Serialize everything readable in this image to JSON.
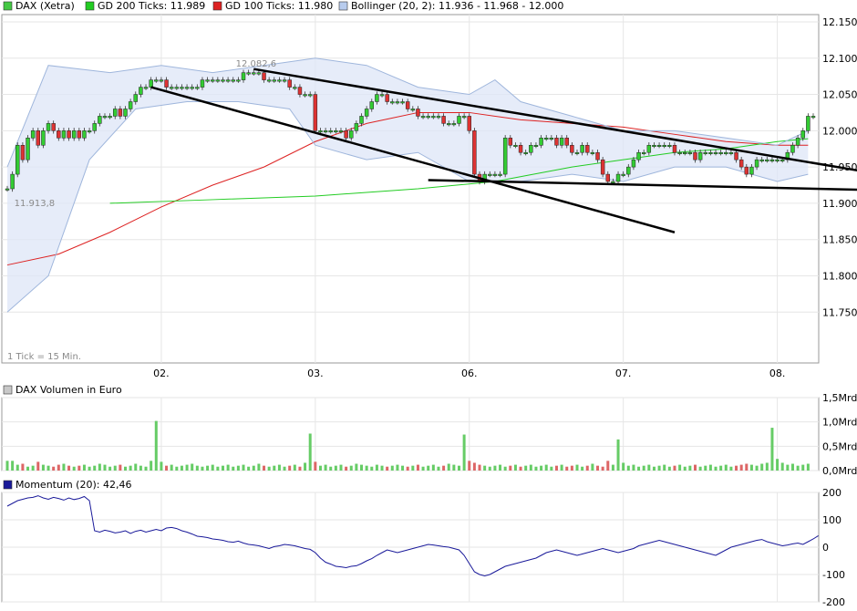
{
  "chart_data": [
    {
      "type": "candlestick",
      "panel": "price",
      "ylim": [
        11.68,
        12.16
      ],
      "grid": true,
      "legend_placement": "top-left",
      "legend": [
        {
          "label": "DAX (Xetra)",
          "color": "#44c844"
        },
        {
          "label": "GD 200 Ticks: 11.989",
          "color": "#22cc22"
        },
        {
          "label": "GD 100 Ticks: 11.980",
          "color": "#dd2222"
        },
        {
          "label": "Bollinger (20, 2): 11.936 - 11.968 - 12.000",
          "color": "#b8ccee"
        }
      ],
      "y_ticks": [
        {
          "value": 11.75,
          "label": "11.750"
        },
        {
          "value": 11.8,
          "label": "11.800"
        },
        {
          "value": 11.85,
          "label": "11.850"
        },
        {
          "value": 11.9,
          "label": "11.900"
        },
        {
          "value": 11.95,
          "label": "11.950"
        },
        {
          "value": 12.0,
          "label": "12.000"
        },
        {
          "value": 12.05,
          "label": "12.050"
        },
        {
          "value": 12.1,
          "label": "12.100"
        },
        {
          "value": 12.15,
          "label": "12.150"
        }
      ],
      "x_ticks": [
        {
          "index": 30,
          "label": "02."
        },
        {
          "index": 60,
          "label": "03."
        },
        {
          "index": 90,
          "label": "06."
        },
        {
          "index": 120,
          "label": "07."
        },
        {
          "index": 150,
          "label": "08."
        }
      ],
      "x_count": 158,
      "annotations": [
        {
          "text": "12.082,6",
          "index": 47,
          "value": 12.082
        },
        {
          "text": "11.913,8",
          "index": 1,
          "value": 11.914
        },
        {
          "text": "1 Tick = 15 Min.",
          "corner": "bottom-left"
        }
      ],
      "closes": [
        11.92,
        11.94,
        11.98,
        11.96,
        11.99,
        12.0,
        11.98,
        12.0,
        12.01,
        12.0,
        11.99,
        12.0,
        11.99,
        12.0,
        11.99,
        12.0,
        12.0,
        12.01,
        12.02,
        12.02,
        12.02,
        12.03,
        12.02,
        12.03,
        12.04,
        12.05,
        12.06,
        12.06,
        12.07,
        12.07,
        12.07,
        12.06,
        12.06,
        12.06,
        12.06,
        12.06,
        12.06,
        12.06,
        12.07,
        12.07,
        12.07,
        12.07,
        12.07,
        12.07,
        12.07,
        12.07,
        12.08,
        12.08,
        12.08,
        12.08,
        12.07,
        12.07,
        12.07,
        12.07,
        12.07,
        12.06,
        12.06,
        12.05,
        12.05,
        12.05,
        12.0,
        12.0,
        12.0,
        12.0,
        12.0,
        12.0,
        11.99,
        12.0,
        12.01,
        12.02,
        12.03,
        12.04,
        12.05,
        12.05,
        12.04,
        12.04,
        12.04,
        12.04,
        12.03,
        12.03,
        12.02,
        12.02,
        12.02,
        12.02,
        12.02,
        12.01,
        12.01,
        12.01,
        12.02,
        12.02,
        12.0,
        11.94,
        11.93,
        11.94,
        11.94,
        11.94,
        11.94,
        11.99,
        11.98,
        11.98,
        11.97,
        11.97,
        11.98,
        11.98,
        11.99,
        11.99,
        11.99,
        11.98,
        11.99,
        11.98,
        11.97,
        11.97,
        11.98,
        11.97,
        11.97,
        11.96,
        11.94,
        11.93,
        11.93,
        11.94,
        11.94,
        11.95,
        11.96,
        11.97,
        11.97,
        11.98,
        11.98,
        11.98,
        11.98,
        11.98,
        11.97,
        11.97,
        11.97,
        11.97,
        11.96,
        11.97,
        11.97,
        11.97,
        11.97,
        11.97,
        11.97,
        11.97,
        11.96,
        11.95,
        11.94,
        11.95,
        11.96,
        11.96,
        11.96,
        11.96,
        11.96,
        11.96,
        11.97,
        11.98,
        11.99,
        12.0,
        12.02,
        12.02
      ],
      "series": [
        {
          "name": "GD 100 Ticks",
          "color": "#dd2222",
          "points": [
            [
              0,
              11.815
            ],
            [
              10,
              11.83
            ],
            [
              20,
              11.86
            ],
            [
              30,
              11.895
            ],
            [
              40,
              11.925
            ],
            [
              50,
              11.95
            ],
            [
              60,
              11.985
            ],
            [
              70,
              12.01
            ],
            [
              80,
              12.025
            ],
            [
              90,
              12.025
            ],
            [
              100,
              12.015
            ],
            [
              110,
              12.01
            ],
            [
              120,
              12.005
            ],
            [
              130,
              11.995
            ],
            [
              140,
              11.985
            ],
            [
              150,
              11.98
            ],
            [
              156,
              11.98
            ]
          ]
        },
        {
          "name": "GD 200 Ticks",
          "color": "#22cc22",
          "points": [
            [
              20,
              11.9
            ],
            [
              40,
              11.905
            ],
            [
              60,
              11.91
            ],
            [
              80,
              11.92
            ],
            [
              95,
              11.93
            ],
            [
              110,
              11.95
            ],
            [
              120,
              11.96
            ],
            [
              130,
              11.97
            ],
            [
              140,
              11.975
            ],
            [
              150,
              11.985
            ],
            [
              156,
              11.989
            ]
          ]
        },
        {
          "name": "Bollinger upper",
          "color": "#9fb6dc",
          "points": [
            [
              0,
              11.95
            ],
            [
              8,
              12.09
            ],
            [
              20,
              12.08
            ],
            [
              30,
              12.09
            ],
            [
              40,
              12.08
            ],
            [
              50,
              12.09
            ],
            [
              60,
              12.1
            ],
            [
              70,
              12.09
            ],
            [
              80,
              12.06
            ],
            [
              90,
              12.05
            ],
            [
              95,
              12.07
            ],
            [
              100,
              12.04
            ],
            [
              110,
              12.02
            ],
            [
              120,
              12.0
            ],
            [
              130,
              12.0
            ],
            [
              140,
              11.99
            ],
            [
              150,
              11.98
            ],
            [
              156,
              12.0
            ]
          ]
        },
        {
          "name": "Bollinger lower",
          "color": "#9fb6dc",
          "points": [
            [
              0,
              11.75
            ],
            [
              8,
              11.8
            ],
            [
              16,
              11.96
            ],
            [
              25,
              12.03
            ],
            [
              35,
              12.04
            ],
            [
              45,
              12.04
            ],
            [
              55,
              12.03
            ],
            [
              60,
              11.98
            ],
            [
              70,
              11.96
            ],
            [
              80,
              11.97
            ],
            [
              90,
              11.93
            ],
            [
              100,
              11.93
            ],
            [
              110,
              11.94
            ],
            [
              120,
              11.93
            ],
            [
              130,
              11.95
            ],
            [
              140,
              11.95
            ],
            [
              150,
              11.93
            ],
            [
              156,
              11.94
            ]
          ]
        }
      ],
      "trendlines": [
        {
          "from": [
            48,
            12.085
          ],
          "to": [
            176,
            11.933
          ]
        },
        {
          "from": [
            28,
            12.06
          ],
          "to": [
            130,
            11.86
          ]
        },
        {
          "from": [
            82,
            11.932
          ],
          "to": [
            183,
            11.916
          ]
        }
      ]
    },
    {
      "type": "bar",
      "panel": "volume",
      "title": "DAX Volumen in Euro",
      "ylim": [
        0,
        1.5
      ],
      "y_ticks": [
        {
          "value": 0,
          "label": "0,0Mrd"
        },
        {
          "value": 0.5,
          "label": "0,5Mrd"
        },
        {
          "value": 1.0,
          "label": "1,0Mrd"
        },
        {
          "value": 1.5,
          "label": "1,5Mrd"
        }
      ],
      "values": [
        0.2,
        0.2,
        0.12,
        0.14,
        0.08,
        0.1,
        0.18,
        0.12,
        0.1,
        0.08,
        0.12,
        0.14,
        0.1,
        0.08,
        0.1,
        0.12,
        0.08,
        0.1,
        0.14,
        0.12,
        0.08,
        0.1,
        0.12,
        0.08,
        0.1,
        0.14,
        0.1,
        0.08,
        0.2,
        1.02,
        0.18,
        0.1,
        0.12,
        0.08,
        0.1,
        0.12,
        0.14,
        0.1,
        0.08,
        0.1,
        0.12,
        0.08,
        0.1,
        0.12,
        0.08,
        0.1,
        0.12,
        0.08,
        0.1,
        0.14,
        0.1,
        0.08,
        0.1,
        0.12,
        0.08,
        0.1,
        0.12,
        0.08,
        0.16,
        0.76,
        0.18,
        0.1,
        0.12,
        0.08,
        0.1,
        0.12,
        0.08,
        0.1,
        0.14,
        0.12,
        0.1,
        0.08,
        0.12,
        0.1,
        0.08,
        0.1,
        0.12,
        0.1,
        0.08,
        0.1,
        0.12,
        0.08,
        0.1,
        0.12,
        0.08,
        0.1,
        0.14,
        0.12,
        0.1,
        0.74,
        0.2,
        0.16,
        0.12,
        0.1,
        0.08,
        0.1,
        0.12,
        0.08,
        0.1,
        0.12,
        0.08,
        0.1,
        0.12,
        0.08,
        0.1,
        0.12,
        0.08,
        0.1,
        0.12,
        0.08,
        0.1,
        0.12,
        0.08,
        0.1,
        0.14,
        0.1,
        0.08,
        0.2,
        0.12,
        0.64,
        0.16,
        0.1,
        0.12,
        0.08,
        0.1,
        0.12,
        0.08,
        0.1,
        0.12,
        0.08,
        0.1,
        0.12,
        0.08,
        0.1,
        0.12,
        0.08,
        0.1,
        0.12,
        0.08,
        0.1,
        0.12,
        0.08,
        0.1,
        0.12,
        0.14,
        0.12,
        0.1,
        0.14,
        0.16,
        0.88,
        0.24,
        0.16,
        0.12,
        0.14,
        0.1,
        0.12,
        0.14
      ],
      "colors_up_down": [
        "#66cc66",
        "#dd6666"
      ]
    },
    {
      "type": "line",
      "panel": "momentum",
      "title": "Momentum (20): 42,46",
      "series_color": "#1a1a9a",
      "ylim": [
        -200,
        200
      ],
      "y_ticks": [
        {
          "value": 200,
          "label": "200"
        },
        {
          "value": 100,
          "label": "100"
        },
        {
          "value": 0,
          "label": "0"
        },
        {
          "value": -100,
          "label": "-100"
        },
        {
          "value": -200,
          "label": "-200"
        }
      ],
      "values": [
        150,
        160,
        170,
        175,
        180,
        182,
        188,
        180,
        175,
        182,
        178,
        172,
        180,
        174,
        178,
        185,
        170,
        60,
        55,
        62,
        58,
        52,
        55,
        60,
        50,
        58,
        62,
        55,
        60,
        65,
        60,
        70,
        72,
        68,
        60,
        55,
        48,
        40,
        38,
        35,
        30,
        28,
        25,
        20,
        18,
        22,
        15,
        10,
        8,
        5,
        0,
        -5,
        2,
        5,
        10,
        8,
        5,
        0,
        -5,
        -8,
        -20,
        -40,
        -55,
        -62,
        -70,
        -72,
        -75,
        -70,
        -68,
        -60,
        -50,
        -42,
        -30,
        -20,
        -10,
        -15,
        -20,
        -15,
        -10,
        -5,
        0,
        5,
        10,
        8,
        5,
        2,
        0,
        -5,
        -10,
        -30,
        -60,
        -90,
        -100,
        -105,
        -100,
        -90,
        -80,
        -70,
        -65,
        -60,
        -55,
        -50,
        -45,
        -40,
        -30,
        -20,
        -15,
        -10,
        -15,
        -20,
        -25,
        -30,
        -25,
        -20,
        -15,
        -10,
        -5,
        -10,
        -15,
        -20,
        -15,
        -10,
        -5,
        5,
        10,
        15,
        20,
        25,
        20,
        15,
        10,
        5,
        0,
        -5,
        -10,
        -15,
        -20,
        -25,
        -30,
        -20,
        -10,
        0,
        5,
        10,
        15,
        20,
        25,
        28,
        20,
        15,
        10,
        5,
        8,
        12,
        15,
        10,
        20,
        30,
        42
      ]
    }
  ]
}
